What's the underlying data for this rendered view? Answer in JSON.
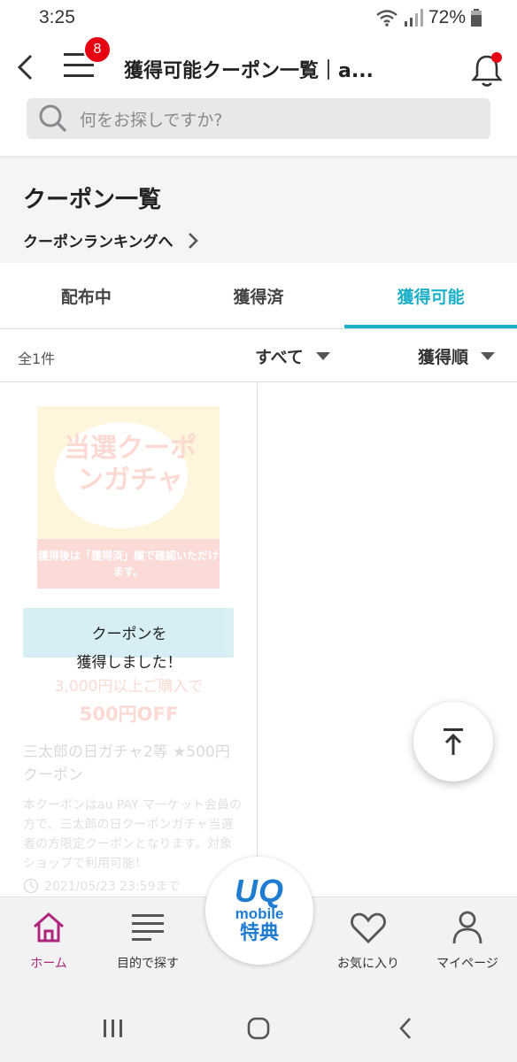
{
  "status_bar": {
    "time": "3:25",
    "battery": "72%"
  },
  "header": {
    "title": "獲得可能クーポン一覧｜a...",
    "menu_badge": "8",
    "search_placeholder": "何をお探しですか?"
  },
  "coupon_section": {
    "heading": "クーポン一覧",
    "ranking_link": "クーポンランキングへ"
  },
  "tabs": [
    {
      "label": "配布中",
      "active": false
    },
    {
      "label": "獲得済",
      "active": false
    },
    {
      "label": "獲得可能",
      "active": true
    }
  ],
  "filter": {
    "count": "全1件",
    "category": "すべて",
    "sort": "獲得順"
  },
  "coupon": {
    "image_title": "当選クーポンガチャ",
    "image_note": "獲得後は「獲得済」欄で確認いただけます。",
    "condition": "3,000円以上ご購入で",
    "discount": "500円OFF",
    "name": "三太郎の日ガチャ2等 ★500円クーポン",
    "description": "本クーポンはau PAY マーケット会員の方で、三太郎の日クーポンガチャ当選者の方限定クーポンとなります。対象ショップで利用可能！",
    "due": "2021/05/23 23:59まで"
  },
  "toast": {
    "line1": "クーポンを",
    "line2": "獲得しました！"
  },
  "bottom_nav": [
    {
      "label": "ホーム",
      "icon": "home-icon",
      "active": true
    },
    {
      "label": "目的で探す",
      "icon": "list-icon",
      "active": false
    },
    {
      "label": "お気に入り",
      "icon": "heart-icon",
      "active": false
    },
    {
      "label": "マイページ",
      "icon": "person-icon",
      "active": false
    }
  ],
  "uq_badge": {
    "logo": "UQ",
    "sub": "mobile",
    "label": "特典"
  },
  "colors": {
    "accent": "#1cb0c8",
    "brand_magenta": "#b0257c",
    "badge_red": "#e60012",
    "uq_blue": "#1f7cd1"
  }
}
